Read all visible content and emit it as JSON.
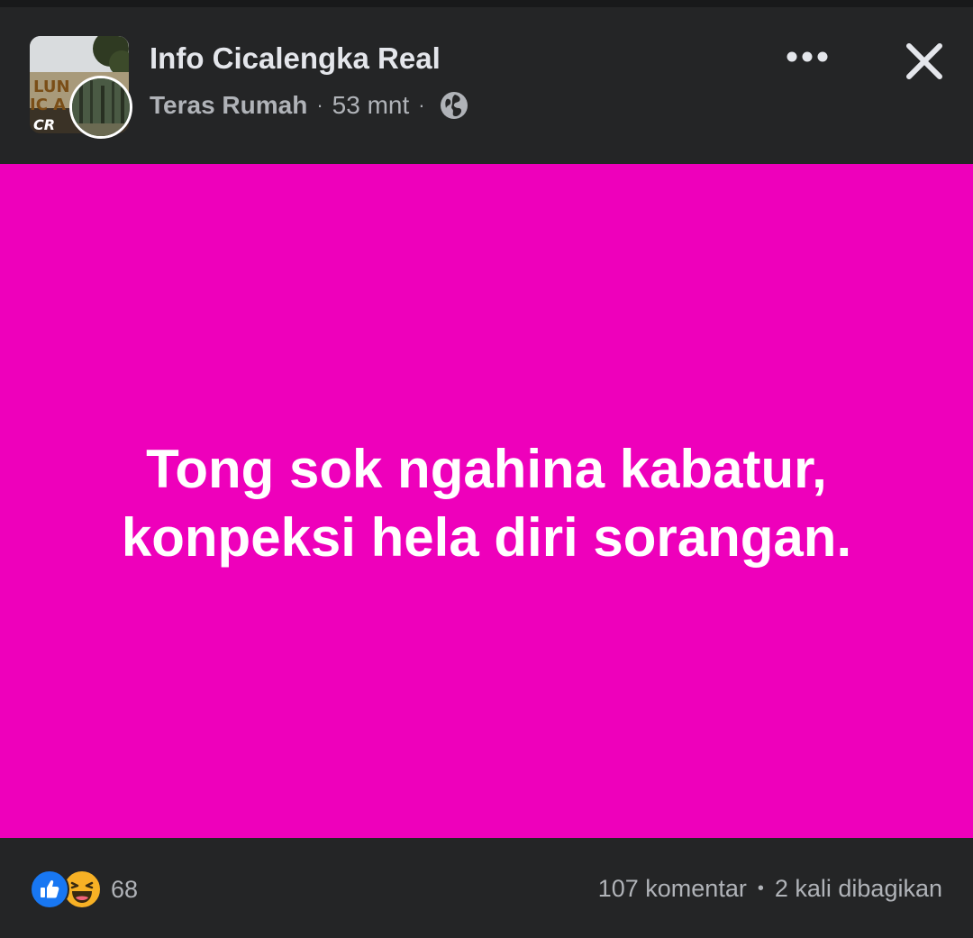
{
  "header": {
    "group_name": "Info Cicalengka Real",
    "author": "Teras Rumah",
    "separator": "·",
    "time": "53 mnt",
    "privacy_icon": "globe-icon",
    "more_icon": "more-dots-icon",
    "close_icon": "close-icon"
  },
  "post": {
    "background_color": "#ee00bb",
    "text_line_1": "Tong sok ngahina kabatur,",
    "text_line_2": "konpeksi hela diri sorangan."
  },
  "footer": {
    "reaction_icons": [
      "like-icon",
      "haha-icon"
    ],
    "reaction_count": "68",
    "comments": "107 komentar",
    "separator": "•",
    "shares": "2 kali dibagikan"
  }
}
